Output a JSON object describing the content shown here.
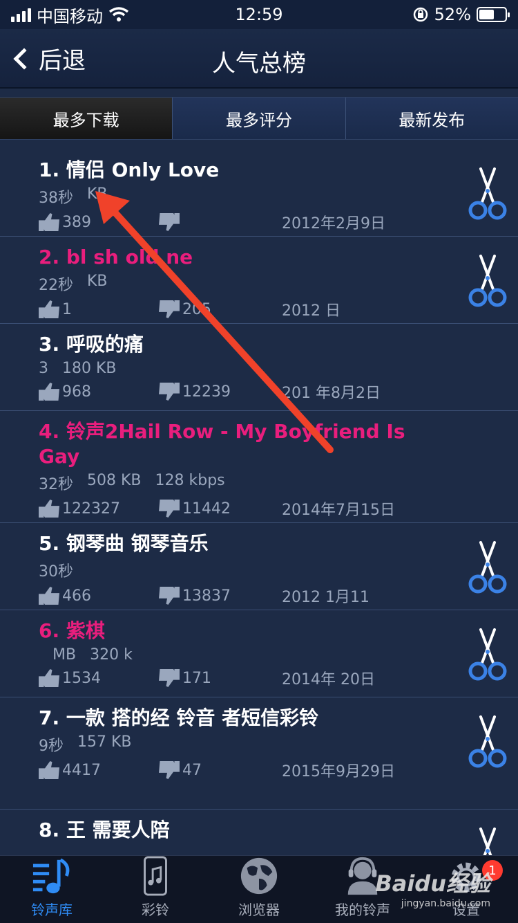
{
  "status": {
    "carrier": "中国移动",
    "time": "12:59",
    "battery": "52%"
  },
  "nav": {
    "back_label": "后退",
    "title": "人气总榜"
  },
  "tabs": [
    "最多下载",
    "最多评分",
    "最新发布"
  ],
  "items": [
    {
      "title": "1. 情侣 Only Love",
      "pink": false,
      "meta": [
        "38秒",
        "KB"
      ],
      "likes": "389",
      "dislikes": "",
      "date": "2012年2月9日",
      "cut": true
    },
    {
      "title": "2. bl sh old ne",
      "pink": true,
      "meta": [
        "22秒",
        "KB"
      ],
      "likes": "1",
      "dislikes": "205",
      "date": "2012 日",
      "cut": true
    },
    {
      "title": "3. 呼吸的痛",
      "pink": false,
      "meta": [
        "3",
        "180 KB"
      ],
      "likes": "968",
      "dislikes": "12239",
      "date": "201 年8月2日",
      "cut": false
    },
    {
      "title": "4. 铃声2Hail Row - My Boyfriend Is Gay",
      "pink": true,
      "meta": [
        "32秒",
        "508 KB",
        "128 kbps"
      ],
      "likes": "122327",
      "dislikes": "11442",
      "date": "2014年7月15日",
      "cut": false
    },
    {
      "title": "5. 钢琴曲 钢琴音乐",
      "pink": false,
      "meta": [
        "30秒"
      ],
      "likes": "466",
      "dislikes": "13837",
      "date": "2012 1月11",
      "cut": true
    },
    {
      "title": "6. 紫棋",
      "pink": true,
      "meta": [
        "",
        "MB",
        "320 k"
      ],
      "likes": "1534",
      "dislikes": "171",
      "date": "2014年 20日",
      "cut": true
    },
    {
      "title": "7. 一款 搭的经 铃音 者短信彩铃",
      "pink": false,
      "meta": [
        "9秒",
        "157 KB"
      ],
      "likes": "4417",
      "dislikes": "47",
      "date": "2015年9月29日",
      "cut": true
    },
    {
      "title": "8. 王 需要人陪",
      "pink": false,
      "meta": [],
      "likes": "",
      "dislikes": "",
      "date": "",
      "cut": true
    }
  ],
  "tabbar": {
    "items": [
      {
        "label": "铃声库",
        "icon": "music-library-icon",
        "active": true
      },
      {
        "label": "彩铃",
        "icon": "phone-music-icon",
        "active": false
      },
      {
        "label": "浏览器",
        "icon": "globe-icon",
        "active": false
      },
      {
        "label": "我的铃声",
        "icon": "headphones-user-icon",
        "active": false
      },
      {
        "label": "设置",
        "icon": "gear-icon",
        "active": false
      }
    ],
    "badge": "1"
  },
  "watermark": {
    "brand": "Baidu经验",
    "url": "jingyan.baidu.com"
  },
  "colors": {
    "accent": "#2f8cf5",
    "pink": "#e91e7d",
    "annotation": "#f0422a"
  }
}
